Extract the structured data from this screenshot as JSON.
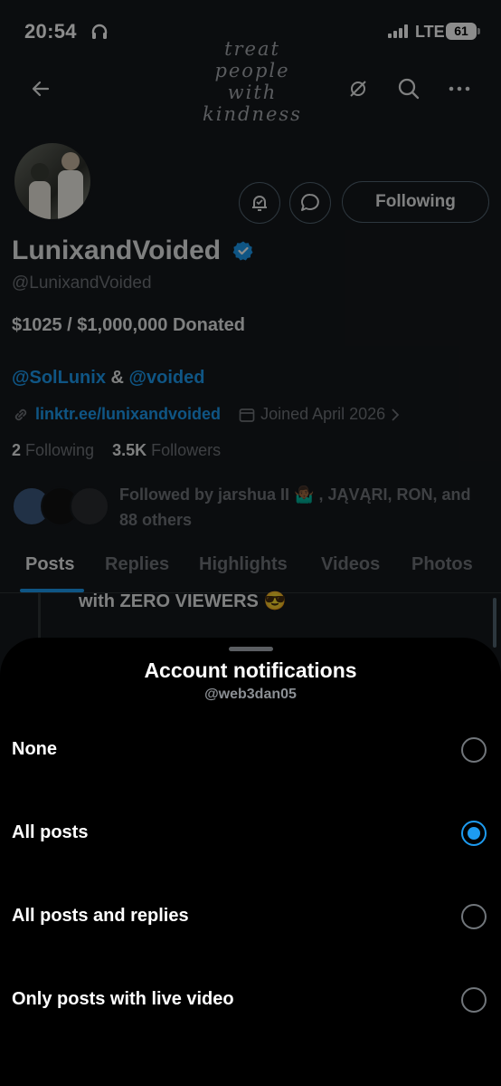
{
  "status_bar": {
    "time": "20:54",
    "carrier": "LTE",
    "battery": "61"
  },
  "banner": {
    "text": "treat people with kindness"
  },
  "profile": {
    "display_name": "LunixandVoided",
    "handle": "@LunixandVoided",
    "bio": "$1025 / $1,000,000 Donated",
    "mention_1": "@SolLunix",
    "mention_sep": "&",
    "mention_2": "@voided",
    "link": "linktr.ee/lunixandvoided",
    "joined": "Joined April 2026",
    "following_count": "2",
    "following_label": "Following",
    "followers_count": "3.5K",
    "followers_label": "Followers",
    "followed_by": "Followed by jarshua II 🤷🏾‍♂️ , JĄVĄRI, RON, and 88 others",
    "following_button": "Following"
  },
  "tabs": [
    "Posts",
    "Replies",
    "Highlights",
    "Videos",
    "Photos"
  ],
  "post_snippet": "with ZERO VIEWERS 😎",
  "sheet": {
    "title": "Account notifications",
    "subtitle": "@web3dan05",
    "options": [
      {
        "label": "None",
        "selected": false
      },
      {
        "label": "All posts",
        "selected": true
      },
      {
        "label": "All posts and replies",
        "selected": false
      },
      {
        "label": "Only posts with live video",
        "selected": false
      }
    ]
  },
  "colors": {
    "accent": "#1d9bf0",
    "sheet_bg": "#000000",
    "page_bg": "#15181c"
  },
  "icons": [
    "headphones-icon",
    "signal-icon",
    "back-arrow-icon",
    "mute-icon",
    "search-icon",
    "more-icon",
    "notification-bell-icon",
    "message-icon",
    "verified-icon",
    "link-icon",
    "calendar-icon",
    "chevron-right-icon"
  ]
}
